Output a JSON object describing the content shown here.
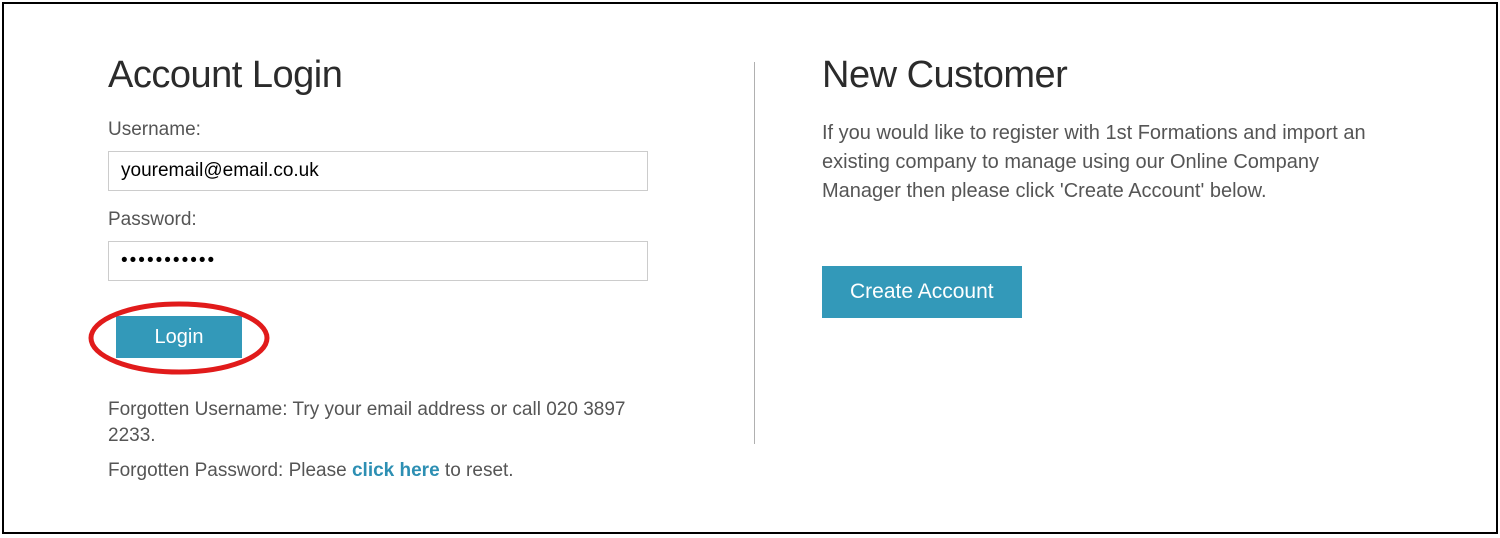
{
  "login": {
    "heading": "Account Login",
    "username_label": "Username:",
    "username_value": "youremail@email.co.uk",
    "password_label": "Password:",
    "password_value": "•••••••••••",
    "login_button": "Login",
    "forgot_username_text": "Forgotten Username: Try your email address or call 020 3897 2233.",
    "forgot_password_prefix": "Forgotten Password: Please ",
    "forgot_password_link": "click here",
    "forgot_password_suffix": " to reset."
  },
  "new_customer": {
    "heading": "New Customer",
    "description": "If you would like to register with 1st Formations and import an existing company to manage using our Online Company Manager then please click 'Create Account' below.",
    "create_button": "Create Account"
  },
  "colors": {
    "accent": "#3399b9",
    "annotation": "#e11b1b"
  }
}
